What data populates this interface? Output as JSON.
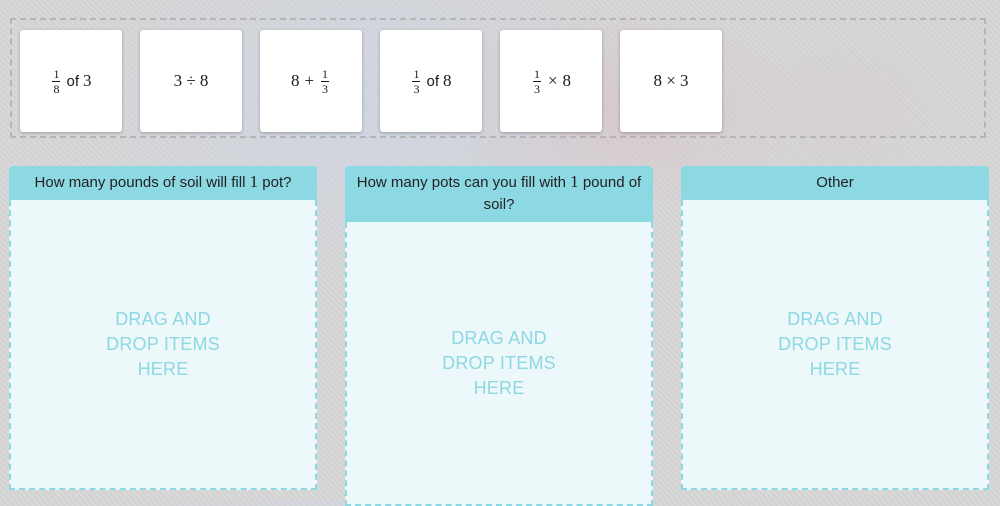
{
  "tiles": [
    {
      "id": "t1",
      "parts": {
        "frac_num": "1",
        "frac_den": "8",
        "word": "of",
        "tail": "3"
      }
    },
    {
      "id": "t2",
      "text": "3 ÷ 8"
    },
    {
      "id": "t3",
      "parts": {
        "lead": "8",
        "op": "+",
        "frac_num": "1",
        "frac_den": "3"
      }
    },
    {
      "id": "t4",
      "parts": {
        "frac_num": "1",
        "frac_den": "3",
        "word": "of",
        "tail": "8"
      }
    },
    {
      "id": "t5",
      "parts": {
        "frac_num": "1",
        "frac_den": "3",
        "op": "×",
        "tail": "8"
      }
    },
    {
      "id": "t6",
      "text": "8 × 3"
    }
  ],
  "bins": [
    {
      "title_pre": "How many pounds of soil will fill ",
      "title_num": "1",
      "title_post": " pot?",
      "hint": "DRAG AND DROP ITEMS HERE"
    },
    {
      "title_pre": "How many pots can you fill with ",
      "title_num": "1",
      "title_post": " pound of soil?",
      "hint": "DRAG AND DROP ITEMS HERE"
    },
    {
      "title_pre": "Other",
      "title_num": "",
      "title_post": "",
      "hint": "DRAG AND DROP ITEMS HERE"
    }
  ],
  "colors": {
    "bin_header": "#8cd8e3",
    "bin_body": "#ecf8fa",
    "hint_text": "#8cd8e3",
    "tile_bg": "#ffffff"
  }
}
